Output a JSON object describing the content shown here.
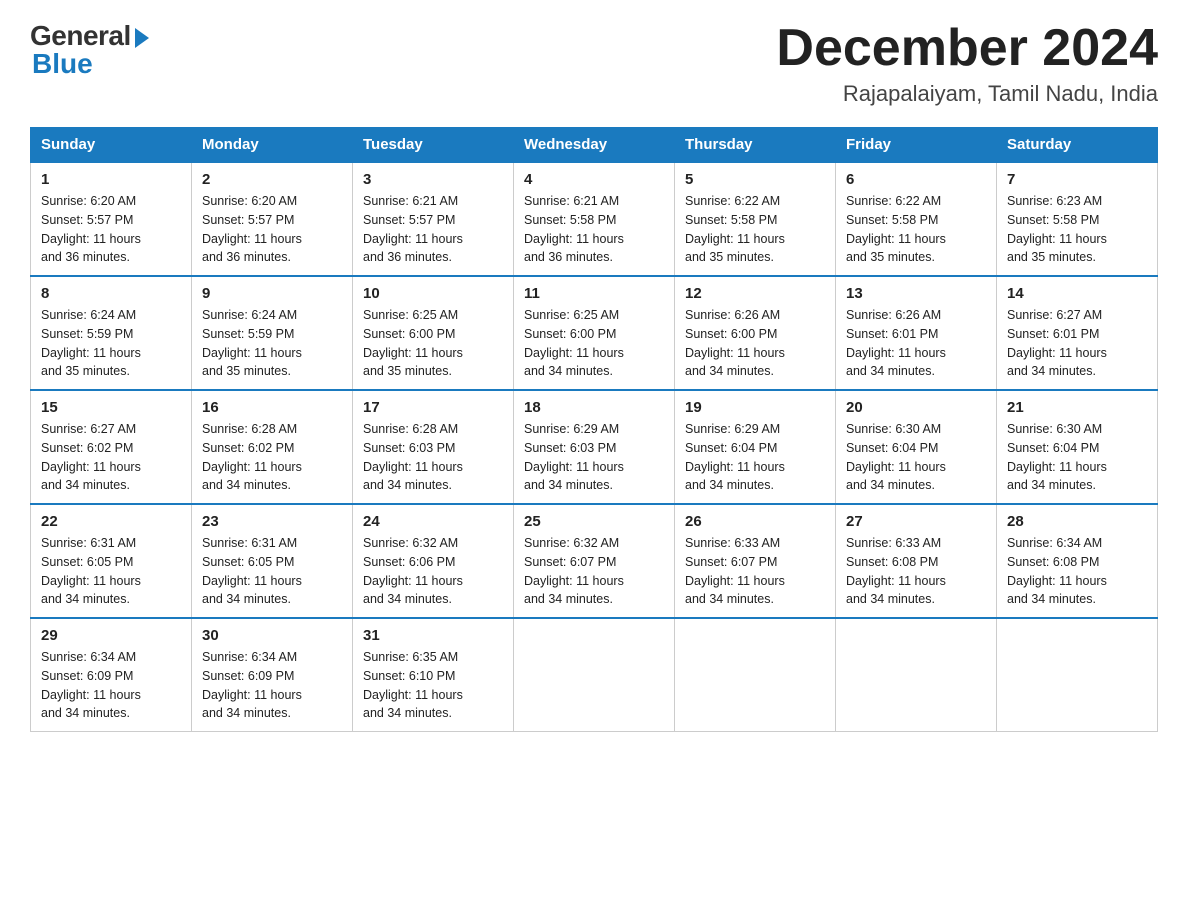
{
  "logo": {
    "general": "General",
    "blue": "Blue"
  },
  "title": "December 2024",
  "subtitle": "Rajapalaiyam, Tamil Nadu, India",
  "days_of_week": [
    "Sunday",
    "Monday",
    "Tuesday",
    "Wednesday",
    "Thursday",
    "Friday",
    "Saturday"
  ],
  "weeks": [
    [
      {
        "day": "1",
        "sunrise": "6:20 AM",
        "sunset": "5:57 PM",
        "daylight": "11 hours and 36 minutes."
      },
      {
        "day": "2",
        "sunrise": "6:20 AM",
        "sunset": "5:57 PM",
        "daylight": "11 hours and 36 minutes."
      },
      {
        "day": "3",
        "sunrise": "6:21 AM",
        "sunset": "5:57 PM",
        "daylight": "11 hours and 36 minutes."
      },
      {
        "day": "4",
        "sunrise": "6:21 AM",
        "sunset": "5:58 PM",
        "daylight": "11 hours and 36 minutes."
      },
      {
        "day": "5",
        "sunrise": "6:22 AM",
        "sunset": "5:58 PM",
        "daylight": "11 hours and 35 minutes."
      },
      {
        "day": "6",
        "sunrise": "6:22 AM",
        "sunset": "5:58 PM",
        "daylight": "11 hours and 35 minutes."
      },
      {
        "day": "7",
        "sunrise": "6:23 AM",
        "sunset": "5:58 PM",
        "daylight": "11 hours and 35 minutes."
      }
    ],
    [
      {
        "day": "8",
        "sunrise": "6:24 AM",
        "sunset": "5:59 PM",
        "daylight": "11 hours and 35 minutes."
      },
      {
        "day": "9",
        "sunrise": "6:24 AM",
        "sunset": "5:59 PM",
        "daylight": "11 hours and 35 minutes."
      },
      {
        "day": "10",
        "sunrise": "6:25 AM",
        "sunset": "6:00 PM",
        "daylight": "11 hours and 35 minutes."
      },
      {
        "day": "11",
        "sunrise": "6:25 AM",
        "sunset": "6:00 PM",
        "daylight": "11 hours and 34 minutes."
      },
      {
        "day": "12",
        "sunrise": "6:26 AM",
        "sunset": "6:00 PM",
        "daylight": "11 hours and 34 minutes."
      },
      {
        "day": "13",
        "sunrise": "6:26 AM",
        "sunset": "6:01 PM",
        "daylight": "11 hours and 34 minutes."
      },
      {
        "day": "14",
        "sunrise": "6:27 AM",
        "sunset": "6:01 PM",
        "daylight": "11 hours and 34 minutes."
      }
    ],
    [
      {
        "day": "15",
        "sunrise": "6:27 AM",
        "sunset": "6:02 PM",
        "daylight": "11 hours and 34 minutes."
      },
      {
        "day": "16",
        "sunrise": "6:28 AM",
        "sunset": "6:02 PM",
        "daylight": "11 hours and 34 minutes."
      },
      {
        "day": "17",
        "sunrise": "6:28 AM",
        "sunset": "6:03 PM",
        "daylight": "11 hours and 34 minutes."
      },
      {
        "day": "18",
        "sunrise": "6:29 AM",
        "sunset": "6:03 PM",
        "daylight": "11 hours and 34 minutes."
      },
      {
        "day": "19",
        "sunrise": "6:29 AM",
        "sunset": "6:04 PM",
        "daylight": "11 hours and 34 minutes."
      },
      {
        "day": "20",
        "sunrise": "6:30 AM",
        "sunset": "6:04 PM",
        "daylight": "11 hours and 34 minutes."
      },
      {
        "day": "21",
        "sunrise": "6:30 AM",
        "sunset": "6:04 PM",
        "daylight": "11 hours and 34 minutes."
      }
    ],
    [
      {
        "day": "22",
        "sunrise": "6:31 AM",
        "sunset": "6:05 PM",
        "daylight": "11 hours and 34 minutes."
      },
      {
        "day": "23",
        "sunrise": "6:31 AM",
        "sunset": "6:05 PM",
        "daylight": "11 hours and 34 minutes."
      },
      {
        "day": "24",
        "sunrise": "6:32 AM",
        "sunset": "6:06 PM",
        "daylight": "11 hours and 34 minutes."
      },
      {
        "day": "25",
        "sunrise": "6:32 AM",
        "sunset": "6:07 PM",
        "daylight": "11 hours and 34 minutes."
      },
      {
        "day": "26",
        "sunrise": "6:33 AM",
        "sunset": "6:07 PM",
        "daylight": "11 hours and 34 minutes."
      },
      {
        "day": "27",
        "sunrise": "6:33 AM",
        "sunset": "6:08 PM",
        "daylight": "11 hours and 34 minutes."
      },
      {
        "day": "28",
        "sunrise": "6:34 AM",
        "sunset": "6:08 PM",
        "daylight": "11 hours and 34 minutes."
      }
    ],
    [
      {
        "day": "29",
        "sunrise": "6:34 AM",
        "sunset": "6:09 PM",
        "daylight": "11 hours and 34 minutes."
      },
      {
        "day": "30",
        "sunrise": "6:34 AM",
        "sunset": "6:09 PM",
        "daylight": "11 hours and 34 minutes."
      },
      {
        "day": "31",
        "sunrise": "6:35 AM",
        "sunset": "6:10 PM",
        "daylight": "11 hours and 34 minutes."
      },
      null,
      null,
      null,
      null
    ]
  ],
  "labels": {
    "sunrise": "Sunrise:",
    "sunset": "Sunset:",
    "daylight": "Daylight:"
  }
}
